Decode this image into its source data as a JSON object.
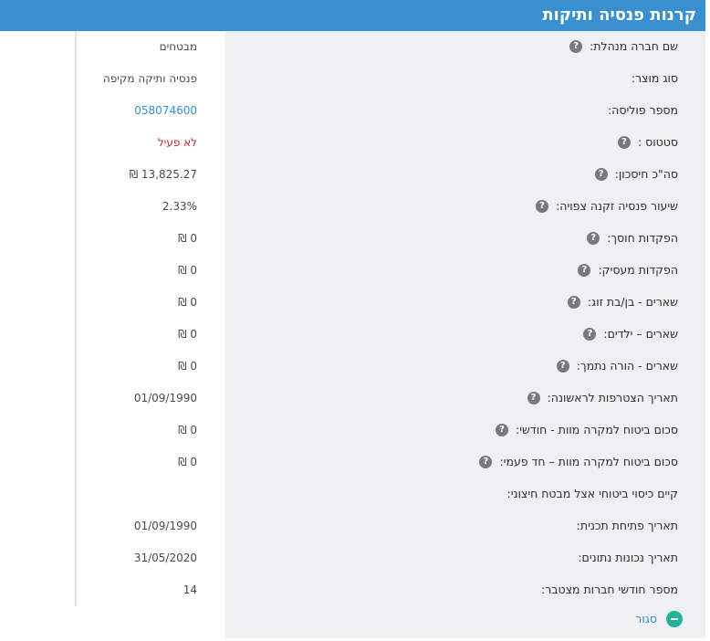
{
  "header": {
    "title": "קרנות פנסיה ותיקות"
  },
  "rows": [
    {
      "label": "שם חברה מנהלת:",
      "help": true,
      "value": "מבטחים",
      "style": "normal"
    },
    {
      "label": "סוג מוצר:",
      "help": false,
      "value": "פנסיה ותיקה מקיפה",
      "style": "normal"
    },
    {
      "label": "מספר פוליסה:",
      "help": false,
      "value": "058074600",
      "style": "link"
    },
    {
      "label": "סטטוס :",
      "help": true,
      "value": "לא פעיל",
      "style": "status"
    },
    {
      "label": "סה\"כ חיסכון:",
      "help": true,
      "value": "13,825.27 ₪",
      "style": "normal"
    },
    {
      "label": "שיעור פנסיה זקנה צפויה:",
      "help": true,
      "value": "2.33%",
      "style": "normal"
    },
    {
      "label": "הפקדות חוסך:",
      "help": true,
      "value": "0 ₪",
      "style": "normal"
    },
    {
      "label": "הפקדות מעסיק:",
      "help": true,
      "value": "0 ₪",
      "style": "normal"
    },
    {
      "label": "שארים - בן/בת זוג:",
      "help": true,
      "value": "0 ₪",
      "style": "normal"
    },
    {
      "label": "שארים – ילדים:",
      "help": true,
      "value": "0 ₪",
      "style": "normal"
    },
    {
      "label": "שארים - הורה נתמך:",
      "help": true,
      "value": "0 ₪",
      "style": "normal"
    },
    {
      "label": "תאריך הצטרפות לראשונה:",
      "help": true,
      "value": "01/09/1990",
      "style": "normal"
    },
    {
      "label": "סכום ביטוח למקרה מוות - חודשי:",
      "help": true,
      "value": "0 ₪",
      "style": "normal"
    },
    {
      "label": "סכום ביטוח למקרה מוות – חד פעמי:",
      "help": true,
      "value": "0 ₪",
      "style": "normal"
    },
    {
      "label": "קיים כיסוי ביטוחי אצל מבטח חיצוני:",
      "help": false,
      "value": "",
      "style": "normal"
    },
    {
      "label": "תאריך פתיחת תכנית:",
      "help": false,
      "value": "01/09/1990",
      "style": "normal"
    },
    {
      "label": "תאריך נכונות נתונים:",
      "help": false,
      "value": "31/05/2020",
      "style": "normal"
    },
    {
      "label": "מספר חודשי חברות מצטבר:",
      "help": false,
      "value": "14",
      "style": "normal"
    }
  ],
  "help_glyph": "?",
  "footer": {
    "close_label": "סגור",
    "close_icon": "minus-circle-icon"
  },
  "colors": {
    "header_bg": "#3a8fce",
    "label_panel_bg": "#eff0f2",
    "link": "#3a8fce",
    "status_inactive": "#b22a2a",
    "close_icon": "#1fb39a"
  }
}
